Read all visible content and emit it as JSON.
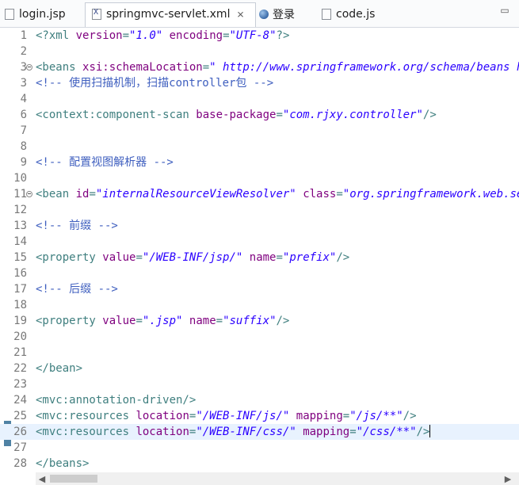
{
  "tabs": [
    {
      "label": "login.jsp",
      "icon": "jsp-file-icon"
    },
    {
      "label": "springmvc-servlet.xml",
      "icon": "xml-file-icon",
      "active": true
    },
    {
      "label": "登录",
      "icon": "browser-globe-icon"
    },
    {
      "label": "code.js",
      "icon": "js-file-icon"
    }
  ],
  "editor": {
    "current_line": 26,
    "lines": [
      {
        "n": "1",
        "fold": false,
        "segs": [
          [
            "tag",
            "<?xml "
          ],
          [
            "attr",
            "version"
          ],
          [
            "tag",
            "="
          ],
          [
            "val",
            "\"1.0\""
          ],
          [
            "tag",
            " "
          ],
          [
            "attr",
            "encoding"
          ],
          [
            "tag",
            "="
          ],
          [
            "val",
            "\"UTF-8\""
          ],
          [
            "tag",
            "?>"
          ]
        ]
      },
      {
        "n": "2",
        "fold": false,
        "segs": []
      },
      {
        "n": "3",
        "fold": true,
        "segs": [
          [
            "tag",
            "<beans "
          ],
          [
            "attr",
            "xsi:schemaLocation"
          ],
          [
            "tag",
            "="
          ],
          [
            "val",
            "\" http://www.springframework.org/schema/beans http://www.springframework.org/schema/beans/spring-beans.xsd\""
          ]
        ]
      },
      {
        "n": "3",
        "fold": false,
        "segs": [
          [
            "cmt",
            "<!-- 使用扫描机制，扫描controller包 -->"
          ]
        ]
      },
      {
        "n": "4",
        "fold": false,
        "segs": []
      },
      {
        "n": "6",
        "fold": false,
        "segs": [
          [
            "tag",
            "<context:component-scan "
          ],
          [
            "attr",
            "base-package"
          ],
          [
            "tag",
            "="
          ],
          [
            "val",
            "\"com.rjxy.controller\""
          ],
          [
            "tag",
            "/>"
          ]
        ]
      },
      {
        "n": "7",
        "fold": false,
        "segs": []
      },
      {
        "n": "8",
        "fold": false,
        "segs": []
      },
      {
        "n": "9",
        "fold": false,
        "segs": [
          [
            "cmt",
            "<!-- 配置视图解析器 -->"
          ]
        ]
      },
      {
        "n": "10",
        "fold": false,
        "segs": []
      },
      {
        "n": "11",
        "fold": true,
        "segs": [
          [
            "tag",
            "<bean "
          ],
          [
            "attr",
            "id"
          ],
          [
            "tag",
            "="
          ],
          [
            "val",
            "\"internalResourceViewResolver\""
          ],
          [
            "tag",
            " "
          ],
          [
            "attr",
            "class"
          ],
          [
            "tag",
            "="
          ],
          [
            "val",
            "\"org.springframework.web.servlet.view.InternalResourceViewResolver\""
          ],
          [
            "tag",
            ">"
          ]
        ]
      },
      {
        "n": "12",
        "fold": false,
        "segs": []
      },
      {
        "n": "13",
        "fold": false,
        "segs": [
          [
            "cmt",
            "<!-- 前缀 -->"
          ]
        ]
      },
      {
        "n": "14",
        "fold": false,
        "segs": []
      },
      {
        "n": "15",
        "fold": false,
        "segs": [
          [
            "tag",
            "<property "
          ],
          [
            "attr",
            "value"
          ],
          [
            "tag",
            "="
          ],
          [
            "val",
            "\"/WEB-INF/jsp/\""
          ],
          [
            "tag",
            " "
          ],
          [
            "attr",
            "name"
          ],
          [
            "tag",
            "="
          ],
          [
            "val",
            "\"prefix\""
          ],
          [
            "tag",
            "/>"
          ]
        ]
      },
      {
        "n": "16",
        "fold": false,
        "segs": []
      },
      {
        "n": "17",
        "fold": false,
        "segs": [
          [
            "cmt",
            "<!-- 后缀 -->"
          ]
        ]
      },
      {
        "n": "18",
        "fold": false,
        "segs": []
      },
      {
        "n": "19",
        "fold": false,
        "segs": [
          [
            "tag",
            "<property "
          ],
          [
            "attr",
            "value"
          ],
          [
            "tag",
            "="
          ],
          [
            "val",
            "\".jsp\""
          ],
          [
            "tag",
            " "
          ],
          [
            "attr",
            "name"
          ],
          [
            "tag",
            "="
          ],
          [
            "val",
            "\"suffix\""
          ],
          [
            "tag",
            "/>"
          ]
        ]
      },
      {
        "n": "20",
        "fold": false,
        "segs": []
      },
      {
        "n": "21",
        "fold": false,
        "segs": []
      },
      {
        "n": "22",
        "fold": false,
        "segs": [
          [
            "tag",
            "</bean>"
          ]
        ]
      },
      {
        "n": "23",
        "fold": false,
        "segs": []
      },
      {
        "n": "24",
        "fold": false,
        "segs": [
          [
            "tag",
            "<mvc:annotation-driven/>"
          ]
        ]
      },
      {
        "n": "25",
        "fold": false,
        "segs": [
          [
            "tag",
            "<mvc:resources "
          ],
          [
            "attr",
            "location"
          ],
          [
            "tag",
            "="
          ],
          [
            "val",
            "\"/WEB-INF/js/\""
          ],
          [
            "tag",
            " "
          ],
          [
            "attr",
            "mapping"
          ],
          [
            "tag",
            "="
          ],
          [
            "val",
            "\"/js/**\""
          ],
          [
            "tag",
            "/>"
          ]
        ]
      },
      {
        "n": "26",
        "fold": false,
        "segs": [
          [
            "tag",
            "<mvc:resources "
          ],
          [
            "attr",
            "location"
          ],
          [
            "tag",
            "="
          ],
          [
            "val",
            "\"/WEB-INF/css/\""
          ],
          [
            "tag",
            " "
          ],
          [
            "attr",
            "mapping"
          ],
          [
            "tag",
            "="
          ],
          [
            "val",
            "\"/css/**\""
          ],
          [
            "tag",
            "/>"
          ]
        ]
      },
      {
        "n": "27",
        "fold": false,
        "segs": []
      },
      {
        "n": "28",
        "fold": false,
        "segs": [
          [
            "tag",
            "</beans>"
          ]
        ]
      }
    ]
  },
  "colors": {
    "tag": "#3f7f7f",
    "attribute": "#7f007f",
    "value": "#2a00ff",
    "comment": "#3f5fbf",
    "current_line": "#e8f2fe"
  }
}
